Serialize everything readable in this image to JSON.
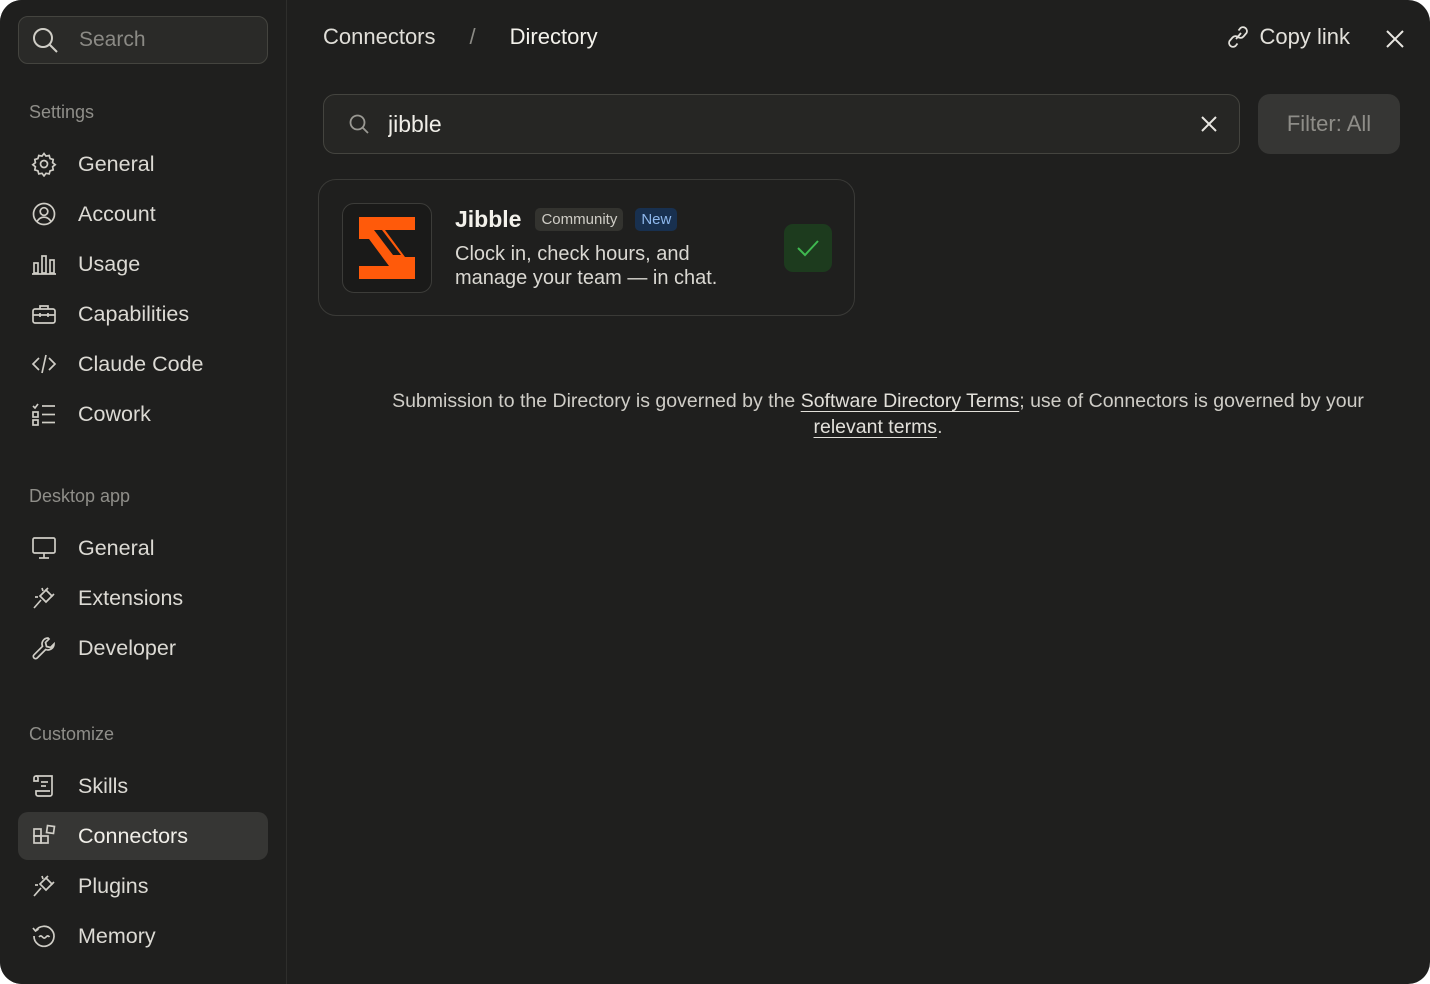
{
  "sidebar": {
    "search_placeholder": "Search",
    "sections": [
      {
        "label": "Settings",
        "items": [
          {
            "label": "General",
            "icon": "gear-icon"
          },
          {
            "label": "Account",
            "icon": "user-circle-icon"
          },
          {
            "label": "Usage",
            "icon": "bar-chart-icon"
          },
          {
            "label": "Capabilities",
            "icon": "toolbox-icon"
          },
          {
            "label": "Claude Code",
            "icon": "code-icon"
          },
          {
            "label": "Cowork",
            "icon": "checklist-icon"
          }
        ]
      },
      {
        "label": "Desktop app",
        "items": [
          {
            "label": "General",
            "icon": "monitor-icon"
          },
          {
            "label": "Extensions",
            "icon": "plug-icon"
          },
          {
            "label": "Developer",
            "icon": "wrench-icon"
          }
        ]
      },
      {
        "label": "Customize",
        "items": [
          {
            "label": "Skills",
            "icon": "scroll-icon"
          },
          {
            "label": "Connectors",
            "icon": "connectors-icon",
            "active": true
          },
          {
            "label": "Plugins",
            "icon": "plug-icon"
          },
          {
            "label": "Memory",
            "icon": "memory-icon"
          }
        ]
      }
    ]
  },
  "header": {
    "breadcrumb_parent": "Connectors",
    "breadcrumb_separator": "/",
    "breadcrumb_current": "Directory",
    "copy_link_label": "Copy link"
  },
  "directory": {
    "search_value": "jibble",
    "filter_label": "Filter: All",
    "results": [
      {
        "name": "Jibble",
        "badges": [
          "Community",
          "New"
        ],
        "description": "Clock in, check hours, and manage your team — in chat.",
        "installed": true
      }
    ]
  },
  "footer": {
    "text_1": "Submission to the Directory is governed by the ",
    "link_1": "Software Directory Terms",
    "text_2": "; use of Connectors is governed by your ",
    "link_2": "relevant terms",
    "text_3": "."
  },
  "colors": {
    "background": "#1f1f1e",
    "active_item": "#363634",
    "jibble_orange": "#ff5a0a",
    "installed_green": "#3fb950",
    "new_badge_bg": "#18304f"
  }
}
